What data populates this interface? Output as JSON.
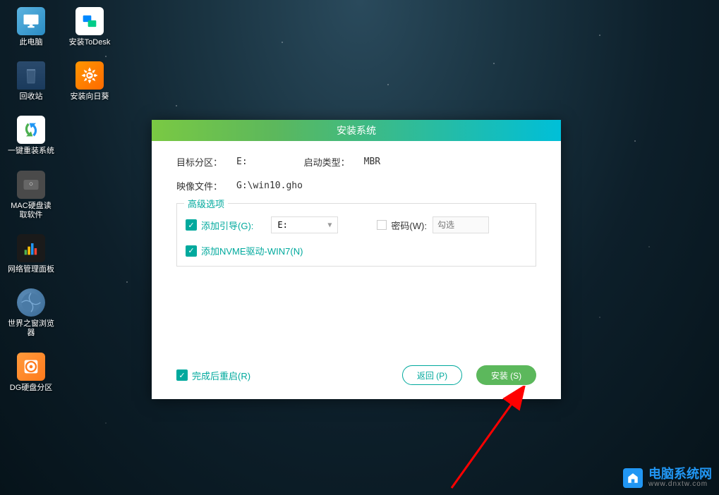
{
  "desktop": {
    "icons": [
      {
        "label": "此电脑",
        "name": "this-pc"
      },
      {
        "label": "安装ToDesk",
        "name": "todesk"
      },
      {
        "label": "回收站",
        "name": "recycle-bin"
      },
      {
        "label": "安装向日葵",
        "name": "sunflower"
      },
      {
        "label": "一键重装系统",
        "name": "reinstall-system"
      },
      {
        "label": "MAC硬盘读取软件",
        "name": "mac-disk"
      },
      {
        "label": "网络管理面板",
        "name": "network-panel"
      },
      {
        "label": "世界之窗浏览器",
        "name": "world-browser"
      },
      {
        "label": "DG硬盘分区",
        "name": "dg-disk"
      }
    ]
  },
  "dialog": {
    "title": "安装系统",
    "targetPartition": {
      "label": "目标分区：",
      "value": "E:"
    },
    "bootType": {
      "label": "启动类型：",
      "value": "MBR"
    },
    "imageFile": {
      "label": "映像文件：",
      "value": "G:\\win10.gho"
    },
    "advancedOptions": {
      "legend": "高级选项",
      "addBoot": {
        "label": "添加引导(G):",
        "value": "E:"
      },
      "password": {
        "label": "密码(W):",
        "placeholder": "勾选"
      },
      "addNvme": {
        "label": "添加NVME驱动-WIN7(N)"
      }
    },
    "restartAfter": {
      "label": "完成后重启(R)"
    },
    "buttons": {
      "back": "返回 (P)",
      "install": "安装 (S)"
    }
  },
  "watermark": {
    "title": "电脑系统网",
    "url": "www.dnxtw.com"
  }
}
